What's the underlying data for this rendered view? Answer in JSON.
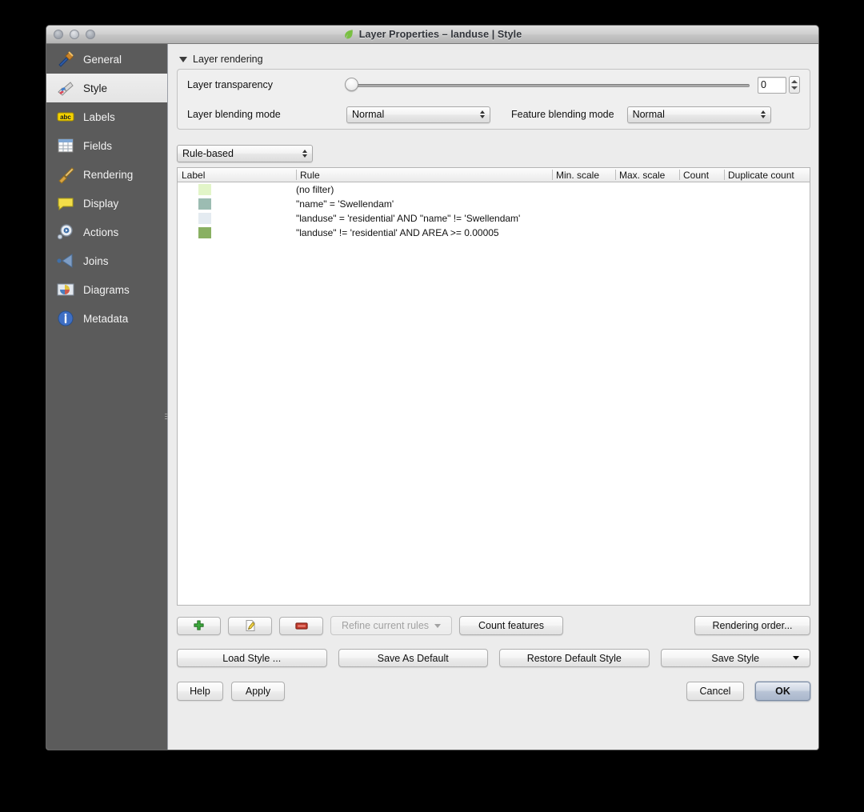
{
  "window": {
    "title": "Layer Properties – landuse | Style",
    "app_icon": "qgis-leaf-icon",
    "traffic_lights": [
      "close-button",
      "minimize-button",
      "zoom-button"
    ]
  },
  "sidebar": {
    "items": [
      {
        "label": "General",
        "icon": "hammer-icon",
        "selected": false
      },
      {
        "label": "Style",
        "icon": "paintbrush-icon",
        "selected": true
      },
      {
        "label": "Labels",
        "icon": "abc-label-icon",
        "selected": false
      },
      {
        "label": "Fields",
        "icon": "table-grid-icon",
        "selected": false
      },
      {
        "label": "Rendering",
        "icon": "broom-icon",
        "selected": false
      },
      {
        "label": "Display",
        "icon": "speech-bubble-icon",
        "selected": false
      },
      {
        "label": "Actions",
        "icon": "gear-play-icon",
        "selected": false
      },
      {
        "label": "Joins",
        "icon": "join-arrow-icon",
        "selected": false
      },
      {
        "label": "Diagrams",
        "icon": "pie-chart-icon",
        "selected": false
      },
      {
        "label": "Metadata",
        "icon": "info-circle-icon",
        "selected": false
      }
    ]
  },
  "layer_rendering": {
    "group_title": "Layer rendering",
    "expanded": true,
    "transparency_label": "Layer transparency",
    "transparency_value": "0",
    "transparency_min": 0,
    "transparency_max": 100,
    "layer_blending_label": "Layer blending mode",
    "layer_blending_value": "Normal",
    "feature_blending_label": "Feature blending mode",
    "feature_blending_value": "Normal"
  },
  "renderer": {
    "selected": "Rule-based"
  },
  "rules_table": {
    "columns": [
      "Label",
      "Rule",
      "Min. scale",
      "Max. scale",
      "Count",
      "Duplicate count"
    ],
    "rows": [
      {
        "label": "",
        "rule": "(no filter)",
        "color": "#e2f5c8",
        "min_scale": "",
        "max_scale": "",
        "count": "",
        "duplicate_count": ""
      },
      {
        "label": "",
        "rule": "\"name\"  =  'Swellendam'",
        "color": "#9cbcb2",
        "min_scale": "",
        "max_scale": "",
        "count": "",
        "duplicate_count": ""
      },
      {
        "label": "",
        "rule": "\"landuse\"  =  'residential' AND \"name\" != 'Swellendam'",
        "color": "#e4ebf1",
        "min_scale": "",
        "max_scale": "",
        "count": "",
        "duplicate_count": ""
      },
      {
        "label": "",
        "rule": "\"landuse\" != 'residential' AND AREA >= 0.00005",
        "color": "#89b062",
        "min_scale": "",
        "max_scale": "",
        "count": "",
        "duplicate_count": ""
      }
    ]
  },
  "toolbar": {
    "add_icon": "green-plus-icon",
    "edit_icon": "pencil-edit-icon",
    "remove_icon": "red-minus-icon",
    "refine_label": "Refine current rules",
    "refine_enabled": false,
    "count_features_label": "Count features",
    "rendering_order_label": "Rendering order..."
  },
  "style_buttons": {
    "load_style": "Load Style ...",
    "save_as_default": "Save As Default",
    "restore_default": "Restore Default Style",
    "save_style": "Save Style"
  },
  "dialog_buttons": {
    "help": "Help",
    "apply": "Apply",
    "cancel": "Cancel",
    "ok": "OK",
    "default_button": "OK"
  },
  "colors": {
    "window_bg": "#ececec",
    "sidebar_bg": "#5b5b5b",
    "sidebar_selected_bg": "#e8e8e8",
    "panel_bg": "#ffffff",
    "ok_accent": "#b9c4d6"
  }
}
